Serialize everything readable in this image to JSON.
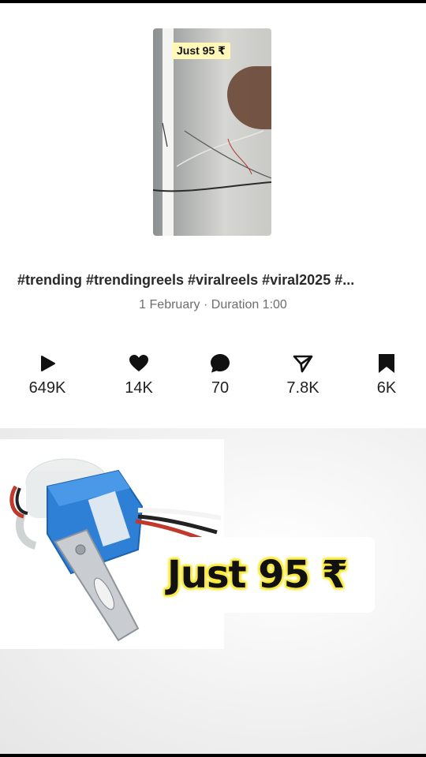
{
  "post": {
    "thumbnail_tag": "Just 95 ₹",
    "caption": "#trending #trendingreels #viralreels #viral2025 #...",
    "meta": "1 February · Duration 1:00"
  },
  "stats": [
    {
      "icon": "play-icon",
      "value": "649K"
    },
    {
      "icon": "heart-icon",
      "value": "14K"
    },
    {
      "icon": "comment-icon",
      "value": "70"
    },
    {
      "icon": "share-icon",
      "value": "7.8K"
    },
    {
      "icon": "bookmark-icon",
      "value": "6K"
    }
  ],
  "banner": {
    "price_text": "Just 95 ₹",
    "product": "photo-sensor-switch",
    "highlight_color": "#f7e83a",
    "product_color": "#2e7fd6"
  }
}
